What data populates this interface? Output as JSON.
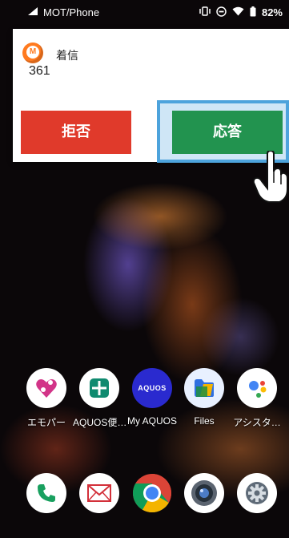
{
  "status_bar": {
    "carrier": "MOT/Phone",
    "battery": "82%",
    "icons": [
      "signal-icon",
      "vibrate-icon",
      "do-not-disturb-icon",
      "wifi-icon",
      "battery-icon"
    ]
  },
  "call_notification": {
    "app_icon": "phone-app-icon",
    "type_label": "着信",
    "caller": "361",
    "reject_label": "拒否",
    "answer_label": "応答",
    "colors": {
      "reject": "#e03a2b",
      "answer": "#22934f",
      "highlight": "#4da3dc"
    }
  },
  "home_apps": [
    {
      "label": "エモパー",
      "icon": "emopa-icon"
    },
    {
      "label": "AQUOS便…",
      "icon": "aquos-grid-icon"
    },
    {
      "label": "My AQUOS",
      "icon": "my-aquos-icon",
      "icon_text": "AQUOS"
    },
    {
      "label": "Files",
      "icon": "files-icon"
    },
    {
      "label": "アシスタ…",
      "icon": "assistant-icon"
    }
  ],
  "dock": [
    {
      "icon": "phone-icon"
    },
    {
      "icon": "mail-icon"
    },
    {
      "icon": "chrome-icon"
    },
    {
      "icon": "camera-icon"
    },
    {
      "icon": "settings-icon"
    }
  ]
}
